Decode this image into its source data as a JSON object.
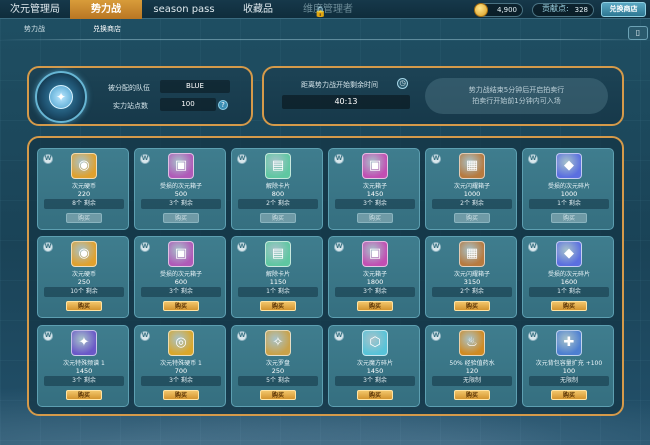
{
  "nav": {
    "tabs": [
      {
        "label": "次元管理局",
        "state": "normal"
      },
      {
        "label": "势力战",
        "state": "active"
      },
      {
        "label": "season pass",
        "state": "normal"
      },
      {
        "label": "收藏品",
        "state": "normal"
      },
      {
        "label": "维度管理者",
        "state": "disabled"
      }
    ],
    "currency_1": "4,900",
    "currency_2": "328",
    "currency_2_prefix": "贡献点:",
    "shop_button": "兑换商店",
    "book_icon": "book-icon"
  },
  "subtabs": [
    {
      "label": "势力战"
    },
    {
      "label": "兑换商店"
    }
  ],
  "team": {
    "assigned_label": "被分配的队伍",
    "assigned_value": "BLUE",
    "points_label": "实力站点数",
    "points_value": "100",
    "help": "?"
  },
  "timer": {
    "label": "距离势力战开始剩余时间",
    "value": "40:13",
    "notice_line1": "势力战结束5分钟后开启拍卖行",
    "notice_line2": "拍卖行开始前1分钟内可入场"
  },
  "cards": [
    {
      "name": "次元硬币",
      "price": "220",
      "stock": "8个 剩余",
      "buy": "购买",
      "buy_on": false,
      "icon": "coin-icon",
      "bg": "#e0a12e",
      "glyph": "◉"
    },
    {
      "name": "受损的次元箱子",
      "price": "500",
      "stock": "3个 剩余",
      "buy": "购买",
      "buy_on": false,
      "icon": "chest-icon",
      "bg": "#b05ab8",
      "glyph": "▣"
    },
    {
      "name": "解除卡片",
      "price": "800",
      "stock": "2个 剩余",
      "buy": "购买",
      "buy_on": false,
      "icon": "ticket-icon",
      "bg": "#5fc7a1",
      "glyph": "▤"
    },
    {
      "name": "次元箱子",
      "price": "1450",
      "stock": "3个 剩余",
      "buy": "购买",
      "buy_on": false,
      "icon": "chest-icon",
      "bg": "#c24fb3",
      "glyph": "▣"
    },
    {
      "name": "次元闪耀箱子",
      "price": "1000",
      "stock": "2个 剩余",
      "buy": "购买",
      "buy_on": false,
      "icon": "box-icon",
      "bg": "#b77a3f",
      "glyph": "▦"
    },
    {
      "name": "受损的次元碎片",
      "price": "1000",
      "stock": "1个 剩余",
      "buy": "购买",
      "buy_on": false,
      "icon": "crystal-icon",
      "bg": "#5b6fe0",
      "glyph": "◆"
    },
    {
      "name": "次元硬币",
      "price": "250",
      "stock": "10个 剩余",
      "buy": "购买",
      "buy_on": true,
      "icon": "coin-icon",
      "bg": "#e0a12e",
      "glyph": "◉"
    },
    {
      "name": "受损的次元箱子",
      "price": "600",
      "stock": "3个 剩余",
      "buy": "购买",
      "buy_on": true,
      "icon": "chest-icon",
      "bg": "#b05ab8",
      "glyph": "▣"
    },
    {
      "name": "解除卡片",
      "price": "1150",
      "stock": "1个 剩余",
      "buy": "购买",
      "buy_on": true,
      "icon": "ticket-icon",
      "bg": "#5fc7a1",
      "glyph": "▤"
    },
    {
      "name": "次元箱子",
      "price": "1800",
      "stock": "3个 剩余",
      "buy": "购买",
      "buy_on": true,
      "icon": "chest-icon",
      "bg": "#c24fb3",
      "glyph": "▣"
    },
    {
      "name": "次元闪耀箱子",
      "price": "3150",
      "stock": "2个 剩余",
      "buy": "购买",
      "buy_on": true,
      "icon": "box-icon",
      "bg": "#b77a3f",
      "glyph": "▦"
    },
    {
      "name": "受损的次元碎片",
      "price": "1600",
      "stock": "1个 剩余",
      "buy": "购买",
      "buy_on": true,
      "icon": "crystal-icon",
      "bg": "#5b6fe0",
      "glyph": "◆"
    },
    {
      "name": "次元特殊频谱 1",
      "price": "1450",
      "stock": "3个 剩余",
      "buy": "购买",
      "buy_on": true,
      "icon": "bag-icon",
      "bg": "#6b58c8",
      "glyph": "✦"
    },
    {
      "name": "次元特殊硬币 1",
      "price": "700",
      "stock": "3个 剩余",
      "buy": "购买",
      "buy_on": true,
      "icon": "gold-coin-icon",
      "bg": "#d9a72b",
      "glyph": "◎"
    },
    {
      "name": "次元罗盘",
      "price": "250",
      "stock": "5个 剩余",
      "buy": "购买",
      "buy_on": true,
      "icon": "compass-icon",
      "bg": "#c9a24a",
      "glyph": "✧"
    },
    {
      "name": "次元魔方碎片",
      "price": "1450",
      "stock": "3个 剩余",
      "buy": "购买",
      "buy_on": true,
      "icon": "cube-icon",
      "bg": "#58c3d8",
      "glyph": "⬡"
    },
    {
      "name": "50% 经验值药水",
      "price": "120",
      "stock": "无限制",
      "buy": "购买",
      "buy_on": true,
      "icon": "potion-icon",
      "bg": "#d08a22",
      "glyph": "♨"
    },
    {
      "name": "次元背包容量扩充 +100",
      "price": "100",
      "stock": "无限制",
      "buy": "购买",
      "buy_on": true,
      "icon": "bag-expand-icon",
      "bg": "#4d7fd1",
      "glyph": "✚"
    }
  ]
}
